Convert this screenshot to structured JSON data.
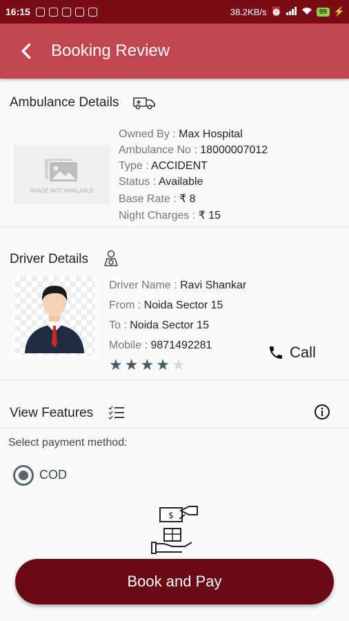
{
  "status_bar": {
    "time": "16:15",
    "network_speed": "38.2KB/s",
    "battery_level": "99"
  },
  "header": {
    "title": "Booking Review"
  },
  "ambulance": {
    "section_title": "Ambulance Details",
    "image_placeholder_text": "IMAGE NOT AVAILABLE",
    "owned_by_label": "Owned By : ",
    "owned_by_value": "Max Hospital",
    "ambulance_no_label": "Ambulance No : ",
    "ambulance_no_value": "18000007012",
    "type_label": "Type : ",
    "type_value": "ACCIDENT",
    "status_label": "Status : ",
    "status_value": "Available",
    "base_rate_label": "Base Rate : ",
    "base_rate_value": "₹ 8",
    "night_charges_label": "Night Charges : ",
    "night_charges_value": "₹ 15"
  },
  "driver": {
    "section_title": "Driver Details",
    "name_label": "Driver Name : ",
    "name_value": "Ravi Shankar",
    "from_label": "From : ",
    "from_value": "Noida Sector 15",
    "to_label": "To : ",
    "to_value": "Noida Sector 15",
    "mobile_label": "Mobile : ",
    "mobile_value": "9871492281",
    "rating": 4,
    "rating_max": 5,
    "call_label": "Call"
  },
  "features": {
    "label": "View Features"
  },
  "payment": {
    "label": "Select payment method:",
    "selected_option": "COD"
  },
  "actions": {
    "book_label": "Book and Pay"
  },
  "colors": {
    "status_bar": "#7a0c15",
    "app_bar": "#c1464f",
    "primary_button": "#6a0a14",
    "star_filled": "#4a5a66",
    "star_empty": "#d6d6d6",
    "radio": "#5a6670"
  }
}
